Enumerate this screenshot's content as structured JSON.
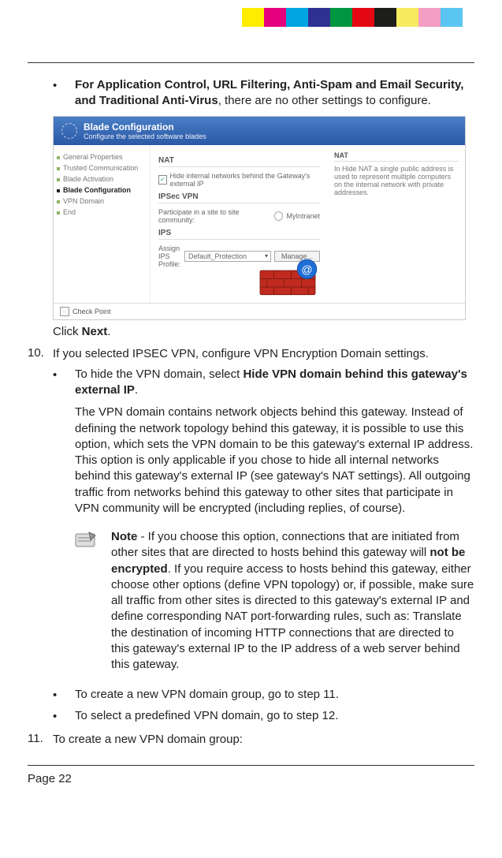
{
  "stripes": [
    "#ffed00",
    "#e6007e",
    "#00a6e2",
    "#2e3192",
    "#009640",
    "#e30613",
    "#1d1d1b",
    "#f6eb61",
    "#f39ec4",
    "#5bc5f2"
  ],
  "bullet1": {
    "bold": "For Application Control, URL Filtering, Anti-Spam and Email Security, and Traditional Anti-Virus",
    "rest": ", there are no other settings to configure."
  },
  "screenshot": {
    "header_title": "Blade Configuration",
    "header_sub": "Configure the selected software blades",
    "sidebar": {
      "items": [
        "General Properties",
        "Trusted Communication",
        "Blade Activation",
        "Blade Configuration",
        "VPN Domain",
        "End"
      ],
      "selected_index": 3
    },
    "nat_title": "NAT",
    "nat_checkbox_label": "Hide internal networks behind the Gateway's external IP",
    "ipsec_title": "IPSec VPN",
    "ipsec_line": "Participate in a site to site community:",
    "ipsec_value": "MyIntranet",
    "ips_title": "IPS",
    "ips_line": "Assign IPS Profile:",
    "ips_value": "Default_Protection",
    "manage_btn": "Manage...",
    "right_title": "NAT",
    "right_text": "In Hide NAT a single public address is used to represent multiple computers on the internal network with private addresses.",
    "footer": "Check Point"
  },
  "click_next_pre": "Click ",
  "click_next_bold": "Next",
  "click_next_post": ".",
  "step10": {
    "num": "10.",
    "text": "If you selected IPSEC VPN, configure VPN Encryption Domain settings."
  },
  "bullet2": {
    "pre": "To hide the VPN domain, select ",
    "bold": "Hide VPN domain behind this gateway's external IP",
    "post": "."
  },
  "para_vpn": "The VPN domain contains network objects behind this gateway. Instead of defining the network topology behind this gateway, it is possible to use this option, which sets the VPN domain to be this gateway's external IP address. This option is only applicable if you chose to hide all internal networks behind this gateway's external IP (see gateway's NAT settings). All outgoing traffic from networks behind this gateway to other sites that participate in VPN community will be encrypted (including replies, of course).",
  "note": {
    "bold1": "Note",
    "mid1": " - If you choose this option, connections that are initiated from other sites that are directed to hosts behind this gateway will ",
    "bold2": "not be encrypted",
    "mid2": ". If you require access to hosts behind this gateway, either choose other options (define VPN topology) or, if possible, make sure all traffic from other sites is directed to this gateway's external IP and define corresponding NAT port-forwarding rules, such as: Translate the destination of incoming HTTP connections that are directed to this gateway's external IP to the IP address of a web server behind this gateway."
  },
  "bullet3": "To create a new VPN domain group, go to step 11.",
  "bullet4": "To select a predefined VPN domain, go to step 12.",
  "step11": {
    "num": "11.",
    "text": "To create a new VPN domain group:"
  },
  "page_num": "Page 22"
}
